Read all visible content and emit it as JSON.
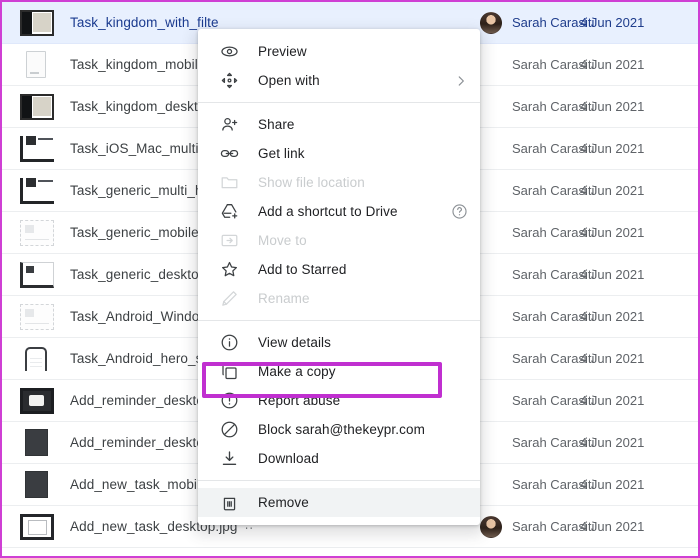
{
  "accent_color": "#c02fd0",
  "frame_border_color": "#cf3fd4",
  "selected_row_color": "#e8f0fe",
  "file_list": {
    "rows": [
      {
        "name": "Task_kingdom_with_filte",
        "owner": "Sarah Carasiti",
        "date": "4 Jun 2021",
        "thumb": "desktop-dark-thumb",
        "selected": true,
        "avatar": true,
        "shared": false
      },
      {
        "name": "Task_kingdom_mobile.jp",
        "owner": "Sarah Carasiti",
        "date": "4 Jun 2021",
        "thumb": "mobile-light-thumb",
        "selected": false,
        "avatar": false,
        "shared": false
      },
      {
        "name": "Task_kingdom_desktop.",
        "owner": "Sarah Carasiti",
        "date": "4 Jun 2021",
        "thumb": "desktop-dark-thumb",
        "selected": false,
        "avatar": false,
        "shared": false
      },
      {
        "name": "Task_iOS_Mac_multi_he",
        "owner": "Sarah Carasiti",
        "date": "4 Jun 2021",
        "thumb": "wireframe-thumb",
        "selected": false,
        "avatar": false,
        "shared": false
      },
      {
        "name": "Task_generic_multi_herc",
        "owner": "Sarah Carasiti",
        "date": "4 Jun 2021",
        "thumb": "wireframe-thumb",
        "selected": false,
        "avatar": false,
        "shared": false
      },
      {
        "name": "Task_generic_mobile_he",
        "owner": "Sarah Carasiti",
        "date": "4 Jun 2021",
        "thumb": "faint-wireframe-thumb",
        "selected": false,
        "avatar": false,
        "shared": false
      },
      {
        "name": "Task_generic_desktop_h",
        "owner": "Sarah Carasiti",
        "date": "4 Jun 2021",
        "thumb": "desktop-outline-thumb",
        "selected": false,
        "avatar": false,
        "shared": false
      },
      {
        "name": "Task_Android_Windows_",
        "owner": "Sarah Carasiti",
        "date": "4 Jun 2021",
        "thumb": "faint-wireframe-thumb",
        "selected": false,
        "avatar": false,
        "shared": false
      },
      {
        "name": "Task_Android_hero_scre",
        "owner": "Sarah Carasiti",
        "date": "4 Jun 2021",
        "thumb": "mobile-rounded-thumb",
        "selected": false,
        "avatar": false,
        "shared": false
      },
      {
        "name": "Add_reminder_desktop.j",
        "owner": "Sarah Carasiti",
        "date": "4 Jun 2021",
        "thumb": "photo-dark-thumb",
        "selected": false,
        "avatar": false,
        "shared": false
      },
      {
        "name": "Add_reminder_desktop-",
        "owner": "Sarah Carasiti",
        "date": "4 Jun 2021",
        "thumb": "solid-dark-thumb",
        "selected": false,
        "avatar": false,
        "shared": false
      },
      {
        "name": "Add_new_task_mobile.jp",
        "owner": "Sarah Carasiti",
        "date": "4 Jun 2021",
        "thumb": "solid-dark-thumb",
        "selected": false,
        "avatar": false,
        "shared": false
      },
      {
        "name": "Add_new_task_desktop.jpg",
        "owner": "Sarah Carasiti",
        "date": "4 Jun 2021",
        "thumb": "document-white-thumb",
        "selected": false,
        "avatar": true,
        "shared": true,
        "shared_glyph": "∴"
      }
    ]
  },
  "context_menu": {
    "groups": [
      {
        "items": [
          {
            "label": "Preview",
            "icon": "eye-icon",
            "disabled": false,
            "trailing": null,
            "hovered": false
          },
          {
            "label": "Open with",
            "icon": "open-with-icon",
            "disabled": false,
            "trailing": "chevron-right-icon",
            "hovered": false
          }
        ]
      },
      {
        "items": [
          {
            "label": "Share",
            "icon": "person-add-icon",
            "disabled": false,
            "trailing": null,
            "hovered": false
          },
          {
            "label": "Get link",
            "icon": "link-icon",
            "disabled": false,
            "trailing": null,
            "hovered": false
          },
          {
            "label": "Show file location",
            "icon": "folder-icon",
            "disabled": true,
            "trailing": null,
            "hovered": false
          },
          {
            "label": "Add a shortcut to Drive",
            "icon": "drive-shortcut-icon",
            "disabled": false,
            "trailing": "help-icon",
            "hovered": false
          },
          {
            "label": "Move to",
            "icon": "move-to-icon",
            "disabled": true,
            "trailing": null,
            "hovered": false
          },
          {
            "label": "Add to Starred",
            "icon": "star-icon",
            "disabled": false,
            "trailing": null,
            "hovered": false
          },
          {
            "label": "Rename",
            "icon": "pencil-icon",
            "disabled": true,
            "trailing": null,
            "hovered": false
          }
        ]
      },
      {
        "items": [
          {
            "label": "View details",
            "icon": "info-icon",
            "disabled": false,
            "trailing": null,
            "hovered": false
          },
          {
            "label": "Make a copy",
            "icon": "copy-icon",
            "disabled": false,
            "trailing": null,
            "hovered": false,
            "highlighted": true
          },
          {
            "label": "Report abuse",
            "icon": "report-icon",
            "disabled": false,
            "trailing": null,
            "hovered": false
          },
          {
            "label": "Block sarah@thekeypr.com",
            "icon": "block-icon",
            "disabled": false,
            "trailing": null,
            "hovered": false
          },
          {
            "label": "Download",
            "icon": "download-icon",
            "disabled": false,
            "trailing": null,
            "hovered": false
          }
        ]
      },
      {
        "items": [
          {
            "label": "Remove",
            "icon": "trash-icon",
            "disabled": false,
            "trailing": null,
            "hovered": true
          }
        ]
      }
    ]
  }
}
